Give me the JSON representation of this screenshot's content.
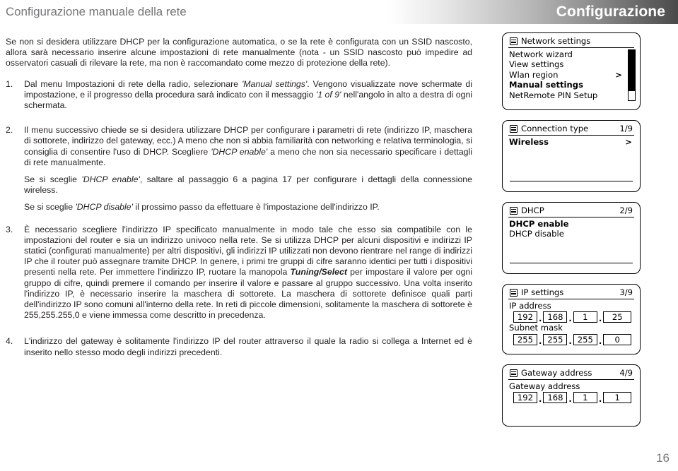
{
  "header": {
    "page_title": "Configurazione manuale della rete",
    "section_title": "Configurazione"
  },
  "content": {
    "intro": "Se non si desidera utilizzare DHCP per la configurazione automatica, o se la rete è configurata con un SSID nascosto, allora sarà necessario inserire alcune impostazioni di rete manualmente (nota - un SSID nascosto può impedire ad osservatori casuali di rilevare la rete, ma non è raccomandato come mezzo di protezione della rete).",
    "steps": [
      {
        "number": "1.",
        "paragraphs": [
          "Dal menu Impostazioni di rete della radio, selezionare 'Manual settings'. Vengono visualizzate nove schermate di impostazione, e il progresso della procedura sarà indicato con il messaggio '1 of 9' nell'angolo in alto a destra di ogni schermata."
        ]
      },
      {
        "number": "2.",
        "paragraphs": [
          "Il menu successivo chiede se si desidera utilizzare DHCP per configurare i parametri di rete (indirizzo IP, maschera di sottorete, indirizzo del gateway, ecc.) A meno che non si abbia familiarità con networking e relativa terminologia, si consiglia di consentire l'uso di DHCP. Scegliere 'DHCP enable' a meno che non sia necessario specificare i dettagli di rete manualmente.",
          "Se si sceglie 'DHCP enable', saltare al passaggio 6 a pagina 17 per configurare i dettagli della connessione wireless.",
          "Se si sceglie 'DHCP disable' il prossimo passo da effettuare è l'impostazione dell'indirizzo IP."
        ]
      },
      {
        "number": "3.",
        "paragraphs": [
          "È necessario scegliere l'indirizzo IP specificato manualmente in modo tale che esso sia compatibile con le impostazioni del router e sia un indirizzo univoco nella rete. Se si utilizza DHCP per alcuni dispositivi e indirizzi IP statici (configurati manualmente) per altri dispositivi, gli indirizzi IP utilizzati non devono rientrare nel range di indirizzi IP che il router può assegnare tramite DHCP. In genere, i primi tre gruppi di cifre saranno identici per tutti i dispositivi presenti nella rete. Per immettere l'indirizzo IP, ruotare la manopola Tuning/Select per impostare il valore per ogni gruppo di cifre, quindi premere il comando per inserire il valore e passare al gruppo successivo. Una volta inserito l'indirizzo IP, è necessario inserire la maschera di sottorete. La maschera di sottorete definisce quali parti dell'indirizzo IP sono comuni all'interno della rete. In reti di piccole dimensioni, solitamente la maschera di sottorete è 255,255.255,0 e viene immessa come descritto in precedenza."
        ]
      },
      {
        "number": "4.",
        "paragraphs": [
          "L'indirizzo del gateway è solitamente l'indirizzo IP del router attraverso il quale la radio si collega a Internet ed è inserito nello stesso modo degli indirizzi precedenti."
        ]
      }
    ]
  },
  "screens": {
    "network_settings": {
      "icon": "menu-list-icon",
      "title": "Network settings",
      "items": [
        {
          "label": "Network wizard",
          "selected": false,
          "arrow": ""
        },
        {
          "label": "View settings",
          "selected": false,
          "arrow": ""
        },
        {
          "label": "Wlan region",
          "selected": false,
          "arrow": ">"
        },
        {
          "label": "Manual settings",
          "selected": true,
          "arrow": ""
        },
        {
          "label": "NetRemote PIN Setup",
          "selected": false,
          "arrow": ""
        }
      ]
    },
    "connection_type": {
      "icon": "menu-list-icon",
      "title": "Connection type",
      "counter": "1/9",
      "items": [
        {
          "label": "Wireless",
          "selected": true,
          "arrow": ">"
        }
      ]
    },
    "dhcp": {
      "icon": "menu-list-icon",
      "title": "DHCP",
      "counter": "2/9",
      "items": [
        {
          "label": "DHCP enable",
          "selected": true,
          "arrow": ""
        },
        {
          "label": "DHCP disable",
          "selected": false,
          "arrow": ""
        }
      ]
    },
    "ip_settings": {
      "icon": "menu-list-icon",
      "title": "IP settings",
      "counter": "3/9",
      "ip_address_label": "IP address",
      "ip_address": [
        "192",
        "168",
        "1",
        "25"
      ],
      "subnet_mask_label": "Subnet mask",
      "subnet_mask": [
        "255",
        "255",
        "255",
        "0"
      ]
    },
    "gateway": {
      "icon": "menu-list-icon",
      "title": "Gateway address",
      "counter": "4/9",
      "gateway_label": "Gateway address",
      "gateway_address": [
        "192",
        "168",
        "1",
        "1"
      ]
    }
  },
  "footer": {
    "page_number": "16"
  }
}
